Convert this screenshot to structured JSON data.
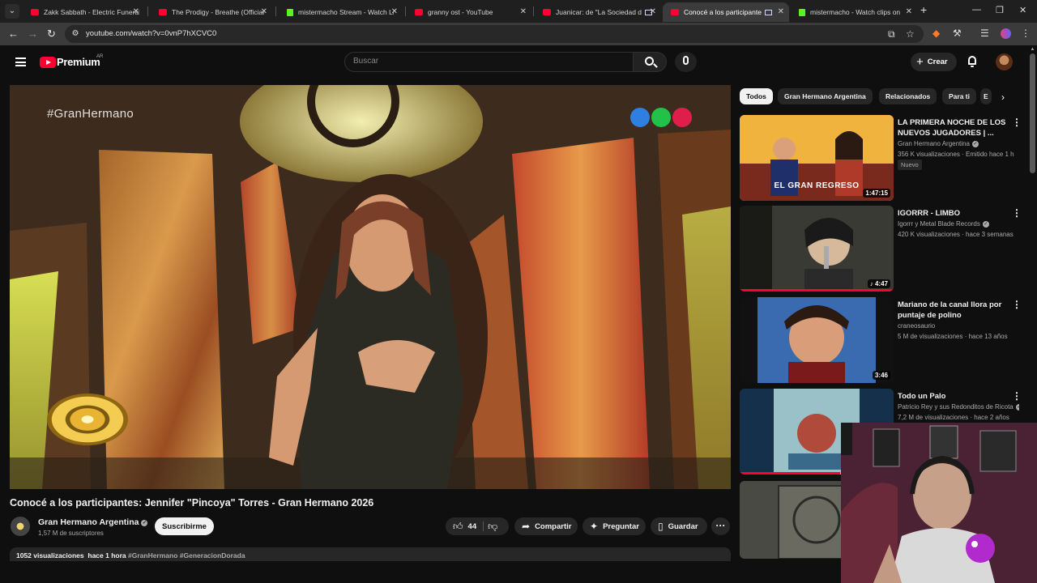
{
  "browser": {
    "tabs": [
      {
        "title": "Zakk Sabbath - Electric Funeral",
        "favicon": "youtube-favicon"
      },
      {
        "title": "The Prodigy - Breathe (Official",
        "favicon": "youtube-favicon"
      },
      {
        "title": "mistermacho Stream - Watch Li",
        "favicon": "kick-favicon"
      },
      {
        "title": "granny ost - YouTube",
        "favicon": "youtube-favicon"
      },
      {
        "title": "Juanicar: de \"La Sociedad d",
        "favicon": "youtube-favicon"
      },
      {
        "title": "Conocé a los participantes",
        "favicon": "youtube-favicon",
        "active": true
      },
      {
        "title": "mistermacho - Watch clips on K",
        "favicon": "kick-favicon"
      }
    ],
    "url": "youtube.com/watch?v=0vnP7hXCVC0"
  },
  "masthead": {
    "logo_text": "Premium",
    "country_code": "AR",
    "search_placeholder": "Buscar",
    "create_label": "Crear"
  },
  "player": {
    "overlay_hashtag": "#GranHermano",
    "channel_dots": [
      "#2f7fe0",
      "#22c24a",
      "#e01e4a"
    ]
  },
  "video": {
    "title": "Conocé a los participantes: Jennifer \"Pincoya\" Torres - Gran Hermano 2026",
    "channel_name": "Gran Hermano Argentina",
    "subscribers": "1,57 M de suscriptores",
    "subscribe_label": "Suscribirme",
    "like_count": "44",
    "share_label": "Compartir",
    "ask_label": "Preguntar",
    "save_label": "Guardar",
    "views": "1052 visualizaciones",
    "published": "hace 1 hora",
    "hashtags": "#GranHermano #GeneracionDorada"
  },
  "chips": [
    "Todos",
    "Gran Hermano Argentina",
    "Relacionados",
    "Para ti",
    "E"
  ],
  "recommendations": [
    {
      "title": "LA PRIMERA NOCHE DE LOS NUEVOS JUGADORES | ...",
      "channel": "Gran Hermano Argentina",
      "verified": true,
      "meta": "356 K visualizaciones · Emitido hace 1 h",
      "duration": "1:47:15",
      "badge": "Nuevo",
      "thumb_text": "EL GRAN REGRESO",
      "watched_fraction": 0
    },
    {
      "title": "IGORRR - LIMBO",
      "channel": "Igorrr y Metal Blade Records",
      "verified": true,
      "meta": "420 K visualizaciones · hace 3 semanas",
      "duration": "4:47",
      "music": true,
      "watched_fraction": 1
    },
    {
      "title": "Mariano de la canal llora por puntaje de polino",
      "channel": "craneosaurio",
      "verified": false,
      "meta": "5 M de visualizaciones · hace 13 años",
      "duration": "3:46",
      "watched_fraction": 0
    },
    {
      "title": "Todo un Palo",
      "channel": "Patricio Rey y sus Redonditos de Ricota",
      "verified": true,
      "meta": "7,2 M de visualizaciones · hace 2 años",
      "duration": "",
      "watched_fraction": 0.65
    },
    {
      "title": "",
      "channel": "",
      "meta": "",
      "duration": "",
      "watched_fraction": 0
    }
  ]
}
